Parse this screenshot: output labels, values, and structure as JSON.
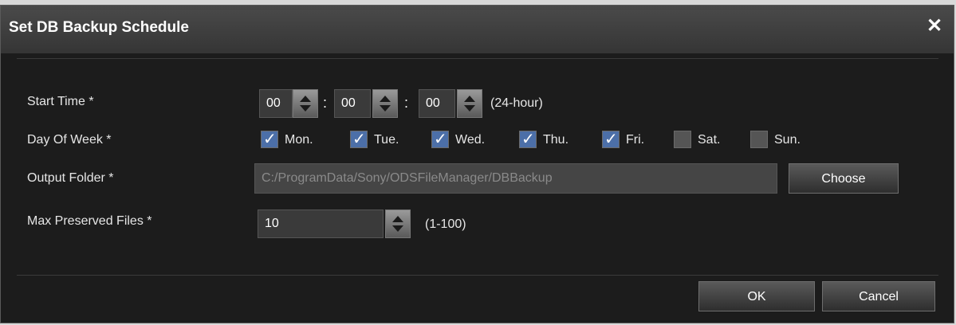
{
  "dialog": {
    "title": "Set DB Backup Schedule",
    "close_glyph": "✕"
  },
  "start_time": {
    "label": "Start Time *",
    "hour": "00",
    "minute": "00",
    "second": "00",
    "separator": ":",
    "hint": "(24-hour)"
  },
  "day_of_week": {
    "label": "Day Of Week *",
    "days": [
      {
        "label": "Mon.",
        "checked": true
      },
      {
        "label": "Tue.",
        "checked": true
      },
      {
        "label": "Wed.",
        "checked": true
      },
      {
        "label": "Thu.",
        "checked": true
      },
      {
        "label": "Fri.",
        "checked": true
      },
      {
        "label": "Sat.",
        "checked": false
      },
      {
        "label": "Sun.",
        "checked": false
      }
    ]
  },
  "output_folder": {
    "label": "Output Folder *",
    "value": "C:/ProgramData/Sony/ODSFileManager/DBBackup",
    "choose_label": "Choose"
  },
  "max_files": {
    "label": "Max Preserved Files *",
    "value": "10",
    "hint": "(1-100)"
  },
  "footer": {
    "ok_label": "OK",
    "cancel_label": "Cancel"
  },
  "colors": {
    "background": "#1c1c1c",
    "titlebar": "#3d3d3d",
    "field": "#3a3a3a",
    "checkbox_checked": "#4c6fa8"
  }
}
